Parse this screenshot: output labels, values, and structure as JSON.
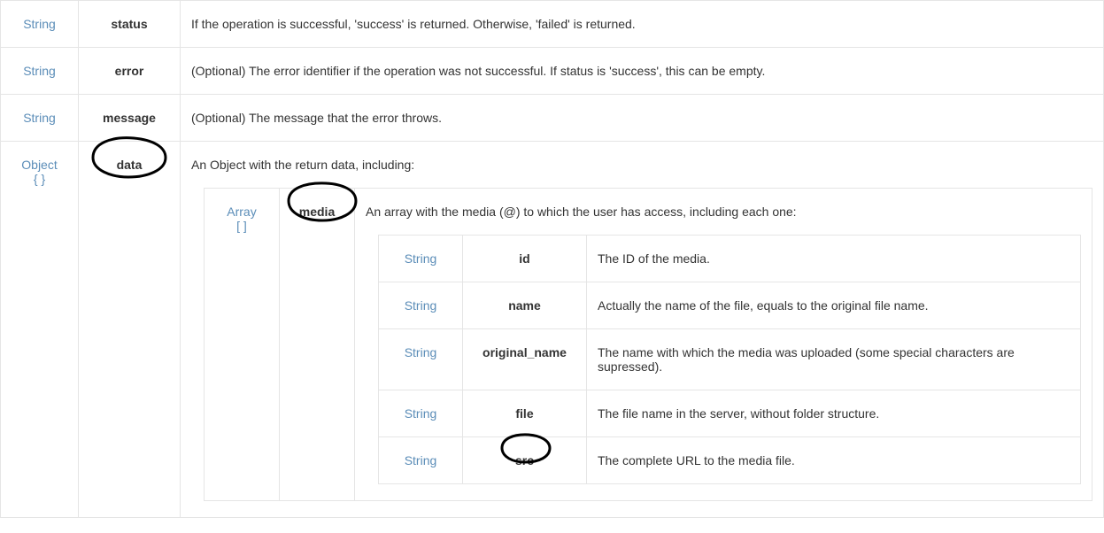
{
  "rows": [
    {
      "type": "String",
      "typesub": "",
      "name": "status",
      "desc": "If the operation is successful, 'success' is returned. Otherwise, 'failed' is returned."
    },
    {
      "type": "String",
      "typesub": "",
      "name": "error",
      "desc": "(Optional) The error identifier if the operation was not successful. If status is 'success', this can be empty."
    },
    {
      "type": "String",
      "typesub": "",
      "name": "message",
      "desc": "(Optional) The message that the error throws."
    }
  ],
  "dataRow": {
    "type": "Object",
    "typesub": "{ }",
    "name": "data",
    "descLead": "An Object with the return data, including:",
    "media": {
      "type": "Array",
      "typesub": "[ ]",
      "name": "media",
      "descLead": "An array with the media (@) to which the user has access, including each one:",
      "fields": [
        {
          "type": "String",
          "name": "id",
          "desc": "The ID of the media."
        },
        {
          "type": "String",
          "name": "name",
          "desc": "Actually the name of the file, equals to the original file name."
        },
        {
          "type": "String",
          "name": "original_name",
          "desc": "The name with which the media was uploaded (some special characters are supressed)."
        },
        {
          "type": "String",
          "name": "file",
          "desc": "The file name in the server, without folder structure."
        },
        {
          "type": "String",
          "name": "src",
          "desc": "The complete URL to the media file."
        }
      ]
    }
  },
  "circles": {
    "data": true,
    "media": true,
    "src": true
  }
}
